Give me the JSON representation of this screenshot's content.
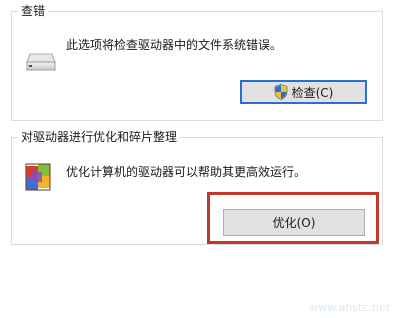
{
  "check_group": {
    "title": "查错",
    "description": "此选项将检查驱动器中的文件系统错误。",
    "button_label": "检查(C)"
  },
  "optimize_group": {
    "title": "对驱动器进行优化和碎片整理",
    "description": "优化计算机的驱动器可以帮助其更高效运行。",
    "button_label": "优化(O)"
  },
  "watermark": "www.ahstc.net",
  "colors": {
    "highlight": "#c0392b",
    "focus_border": "#2f6ecf",
    "button_face": "#e1e1e1"
  },
  "icons": {
    "drive": "drive-icon",
    "shield": "uac-shield-icon",
    "defrag": "defrag-icon"
  }
}
